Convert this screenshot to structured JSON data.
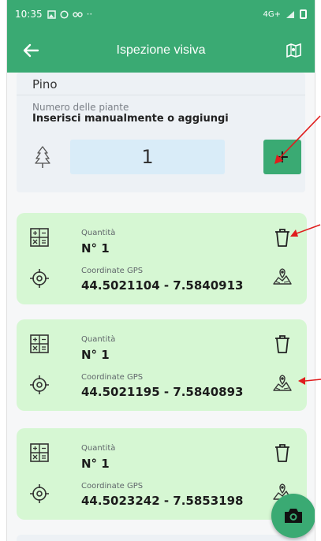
{
  "status_bar": {
    "time": "10:35",
    "network": "4G+"
  },
  "header": {
    "title": "Ispezione visiva"
  },
  "species": "Pino",
  "plants": {
    "label": "Numero delle piante",
    "hint": "Inserisci manualmente o aggiungi",
    "value": "1",
    "add_label": "+"
  },
  "entries": [
    {
      "quantity_label": "Quantità",
      "quantity": "N° 1",
      "gps_label": "Coordinate GPS",
      "gps": "44.5021104 - 7.5840913"
    },
    {
      "quantity_label": "Quantità",
      "quantity": "N° 1",
      "gps_label": "Coordinate GPS",
      "gps": "44.5021195 - 7.5840893"
    },
    {
      "quantity_label": "Quantità",
      "quantity": "N° 1",
      "gps_label": "Coordinate GPS",
      "gps": "44.5023242 - 7.5853198"
    }
  ],
  "colors": {
    "primary": "#3aaa73",
    "card": "#d6f7d3",
    "input": "#d9ecf8",
    "annotation": "#e01d1d"
  },
  "icons": {
    "back": "arrow-left-icon",
    "header_right": "map-trees-icon",
    "tree": "tree-icon",
    "calculator": "calculator-icon",
    "gps": "crosshair-icon",
    "delete": "trash-icon",
    "map": "map-pin-icon",
    "camera": "camera-icon"
  }
}
